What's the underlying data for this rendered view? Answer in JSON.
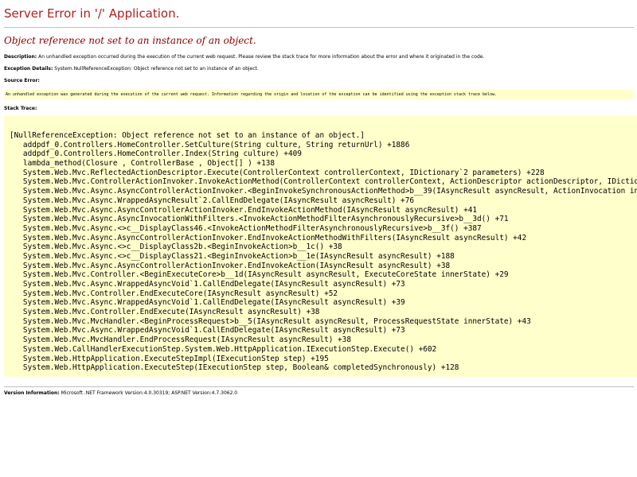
{
  "header": {
    "title": "Server Error in '/' Application.",
    "error_message": "Object reference not set to an instance of an object."
  },
  "description": {
    "label": "Description:",
    "text": "An unhandled exception occurred during the execution of the current web request. Please review the stack trace for more information about the error and where it originated in the code."
  },
  "exception_details": {
    "label": "Exception Details:",
    "text": "System.NullReferenceException: Object reference not set to an instance of an object."
  },
  "source_error": {
    "label": "Source Error:",
    "text": "An unhandled exception was generated during the execution of the current web request. Information regarding the origin and location of the exception can be identified using the exception stack trace below."
  },
  "stack_trace": {
    "label": "Stack Trace:",
    "lines": [
      "[NullReferenceException: Object reference not set to an instance of an object.]",
      "   addpdf_0.Controllers.HomeController.SetCulture(String culture, String returnUrl) +1886",
      "   addpdf_0.Controllers.HomeController.Index(String culture) +409",
      "   lambda_method(Closure , ControllerBase , Object[] ) +138",
      "   System.Web.Mvc.ReflectedActionDescriptor.Execute(ControllerContext controllerContext, IDictionary`2 parameters) +228",
      "   System.Web.Mvc.ControllerActionInvoker.InvokeActionMethod(ControllerContext controllerContext, ActionDescriptor actionDescriptor, IDictionary`2",
      "   System.Web.Mvc.Async.AsyncControllerActionInvoker.<BeginInvokeSynchronousActionMethod>b__39(IAsyncResult asyncResult, ActionInvocation innerI",
      "   System.Web.Mvc.Async.WrappedAsyncResult`2.CallEndDelegate(IAsyncResult asyncResult) +76",
      "   System.Web.Mvc.Async.AsyncControllerActionInvoker.EndInvokeActionMethod(IAsyncResult asyncResult) +41",
      "   System.Web.Mvc.Async.AsyncInvocationWithFilters.<InvokeActionMethodFilterAsynchronouslyRecursive>b__3d() +71",
      "   System.Web.Mvc.Async.<>c__DisplayClass46.<InvokeActionMethodFilterAsynchronouslyRecursive>b__3f() +387",
      "   System.Web.Mvc.Async.AsyncControllerActionInvoker.EndInvokeActionMethodWithFilters(IAsyncResult asyncResult) +42",
      "   System.Web.Mvc.Async.<>c__DisplayClass2b.<BeginInvokeAction>b__1c() +38",
      "   System.Web.Mvc.Async.<>c__DisplayClass21.<BeginInvokeAction>b__1e(IAsyncResult asyncResult) +188",
      "   System.Web.Mvc.Async.AsyncControllerActionInvoker.EndInvokeAction(IAsyncResult asyncResult) +38",
      "   System.Web.Mvc.Controller.<BeginExecuteCore>b__1d(IAsyncResult asyncResult, ExecuteCoreState innerState) +29",
      "   System.Web.Mvc.Async.WrappedAsyncVoid`1.CallEndDelegate(IAsyncResult asyncResult) +73",
      "   System.Web.Mvc.Controller.EndExecuteCore(IAsyncResult asyncResult) +52",
      "   System.Web.Mvc.Async.WrappedAsyncVoid`1.CallEndDelegate(IAsyncResult asyncResult) +39",
      "   System.Web.Mvc.Controller.EndExecute(IAsyncResult asyncResult) +38",
      "   System.Web.Mvc.MvcHandler.<BeginProcessRequest>b__5(IAsyncResult asyncResult, ProcessRequestState innerState) +43",
      "   System.Web.Mvc.Async.WrappedAsyncVoid`1.CallEndDelegate(IAsyncResult asyncResult) +73",
      "   System.Web.Mvc.MvcHandler.EndProcessRequest(IAsyncResult asyncResult) +38",
      "   System.Web.CallHandlerExecutionStep.System.Web.HttpApplication.IExecutionStep.Execute() +602",
      "   System.Web.HttpApplication.ExecuteStepImpl(IExecutionStep step) +195",
      "   System.Web.HttpApplication.ExecuteStep(IExecutionStep step, Boolean& completedSynchronously) +128"
    ]
  },
  "version_info": {
    "label": "Version Information:",
    "text": "Microsoft .NET Framework Version:4.0.30319; ASP.NET Version:4.7.3062.0"
  },
  "colors": {
    "title": "#b02020",
    "error_message": "#8b0000",
    "code_background": "#ffffcc",
    "divider": "#c0c0c0"
  }
}
